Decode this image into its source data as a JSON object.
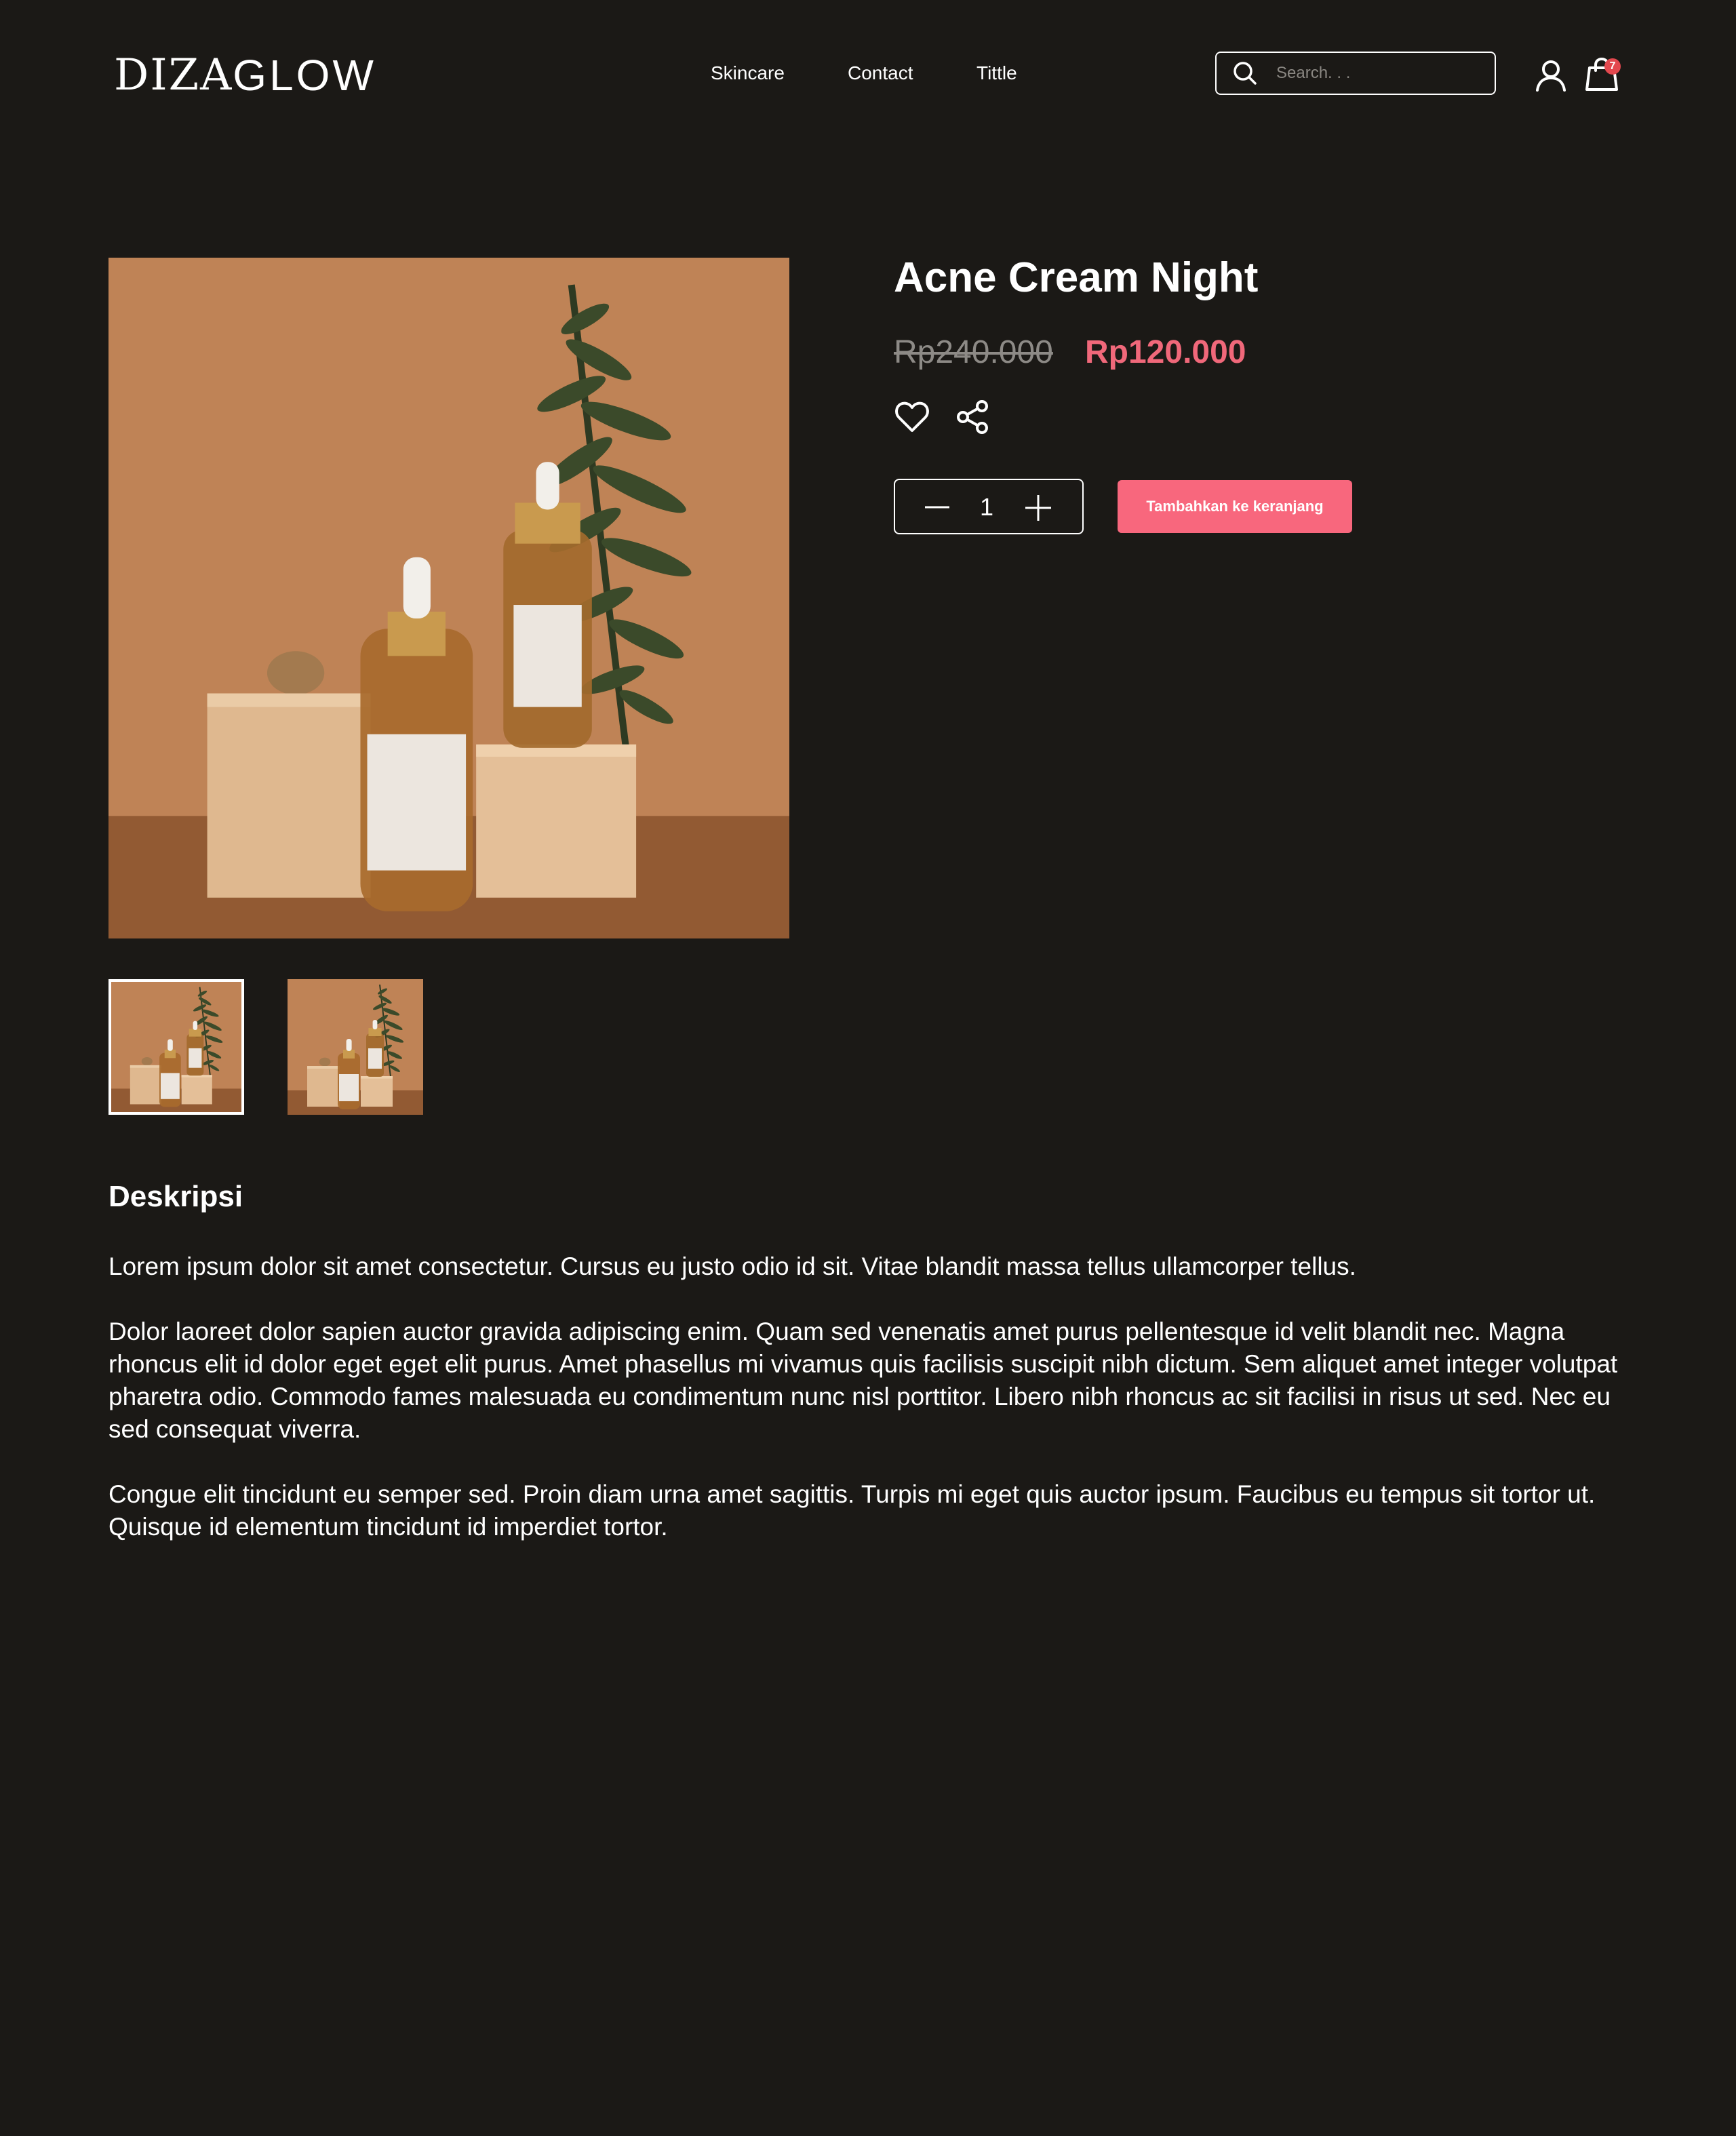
{
  "header": {
    "logo_bold": "DIZA",
    "logo_light": "GLOW",
    "nav": [
      "Skincare",
      "Contact",
      "Tittle"
    ],
    "search_placeholder": "Search. . .",
    "cart_count": "7",
    "icons": [
      "search-icon",
      "user-icon",
      "cart-icon"
    ]
  },
  "product": {
    "title": "Acne Cream Night",
    "old_price": "Rp240.000",
    "new_price": "Rp120.000",
    "quantity": "1",
    "add_to_cart_label": "Tambahkan ke keranjang",
    "icons": [
      "heart-icon",
      "share-icon",
      "minus-icon",
      "plus-icon"
    ]
  },
  "description": {
    "title": "Deskripsi",
    "paragraphs": [
      "Lorem ipsum dolor sit amet consectetur. Cursus eu justo odio id sit. Vitae blandit massa tellus ullamcorper tellus.",
      "Dolor laoreet dolor sapien auctor gravida adipiscing enim. Quam sed venenatis amet purus pellentesque id velit blandit nec. Magna rhoncus elit id dolor eget eget elit purus. Amet phasellus mi vivamus quis facilisis suscipit nibh dictum. Sem aliquet amet integer volutpat pharetra odio. Commodo fames malesuada eu condimentum nunc nisl porttitor. Libero nibh rhoncus ac sit facilisi in risus ut sed. Nec eu sed consequat viverra.",
      "Congue elit tincidunt eu semper sed. Proin diam urna amet sagittis. Turpis mi eget quis auctor ipsum. Faucibus eu tempus sit tortor ut. Quisque id elementum tincidunt id imperdiet tortor."
    ]
  },
  "colors": {
    "background": "#1b1916",
    "accent": "#f8677d",
    "price_sale": "#f0687a",
    "price_old": "#8d8a86"
  }
}
